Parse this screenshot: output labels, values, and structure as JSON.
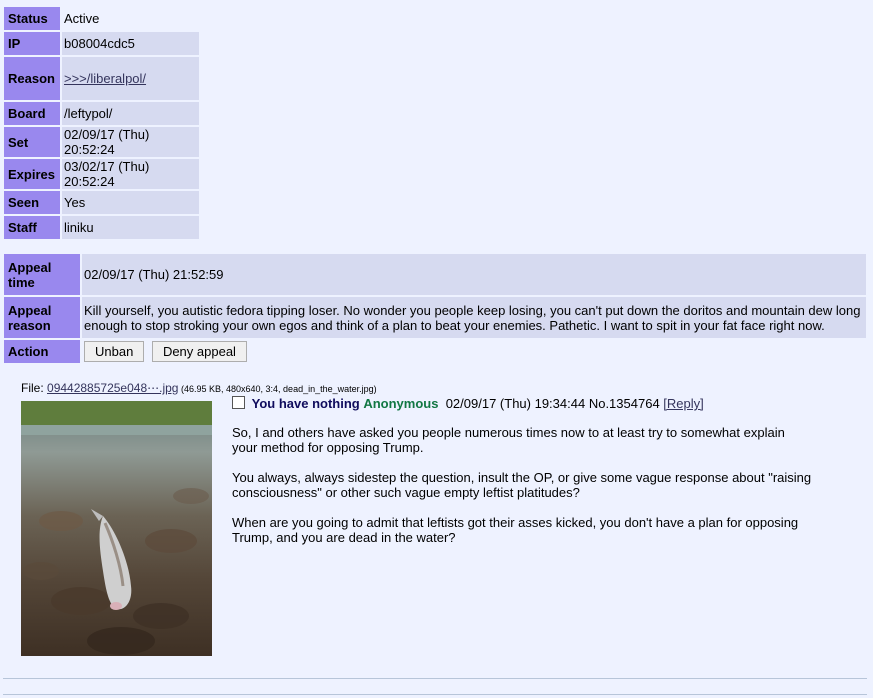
{
  "ban": {
    "status_label": "Status",
    "status_value": "Active",
    "ip_label": "IP",
    "ip_value": "b08004cdc5",
    "reason_label": "Reason",
    "reason_value": ">>>/liberalpol/",
    "board_label": "Board",
    "board_value": "/leftypol/",
    "set_label": "Set",
    "set_value": "02/09/17 (Thu) 20:52:24",
    "expires_label": "Expires",
    "expires_value": "03/02/17 (Thu) 20:52:24",
    "seen_label": "Seen",
    "seen_value": "Yes",
    "staff_label": "Staff",
    "staff_value": "liniku"
  },
  "appeal": {
    "time_label": "Appeal time",
    "time_value": "02/09/17 (Thu) 21:52:59",
    "reason_label": "Appeal reason",
    "reason_value": "Kill yourself, you autistic fedora tipping loser. No wonder you people keep losing, you can't put down the doritos and mountain dew long enough to stop stroking your own egos and think of a plan to beat your enemies. Pathetic. I want to spit in your fat face right now.",
    "action_label": "Action",
    "unban_label": "Unban",
    "deny_label": "Deny appeal"
  },
  "post": {
    "file_prefix": "File: ",
    "file_name": "09442885725e048⋯.jpg",
    "file_meta": " (46.95 KB, 480x640, 3:4, dead_in_the_water.jpg)",
    "subject": "You have nothing",
    "name": "Anonymous",
    "date": "02/09/17 (Thu) 19:34:44",
    "number": "No.1354764",
    "reply": "[Reply]",
    "body": [
      "So, I and others have asked you people numerous times now to at least try to somewhat explain your method for opposing Trump.",
      "You always, always sidestep the question, insult the OP, or give some vague response about \"raising consciousness\" or other such vague empty leftist platitudes?",
      "When are you going to admit that leftists got their asses kicked, you don't have a plan for opposing Trump, and you are dead in the water?"
    ]
  },
  "colors": {
    "background": "#eef2ff",
    "header_cell": "#9988ee",
    "value_cell": "#d6daf0",
    "subject": "#0f0c5d",
    "name": "#117743",
    "link": "#34345c"
  }
}
